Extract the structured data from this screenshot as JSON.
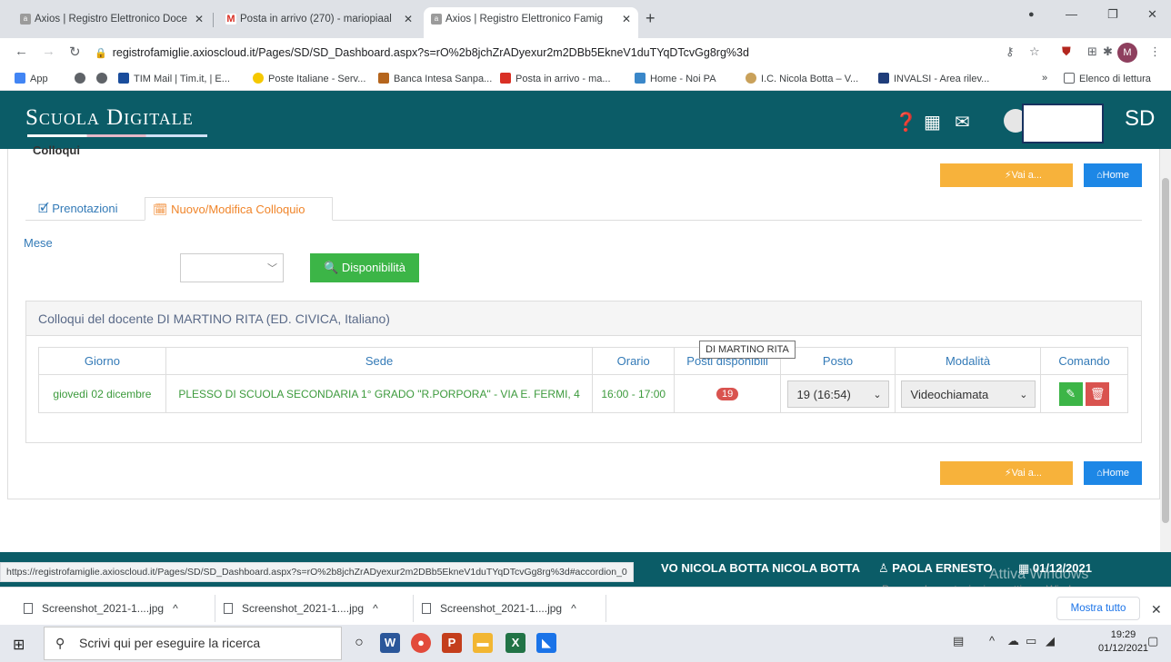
{
  "browser": {
    "tabs": [
      {
        "label": "Axios | Registro Elettronico Doce",
        "active": false
      },
      {
        "label": "Posta in arrivo (270) - mariopiaal",
        "active": false
      },
      {
        "label": "Axios | Registro Elettronico Famig",
        "active": true
      }
    ],
    "url": "registrofamiglie.axioscloud.it/Pages/SD/SD_Dashboard.aspx?s=rO%2b8jchZrADyexur2m2DBb5EkneV1duTYqDTcvGg8rg%3d",
    "profile_initial": "M",
    "bookmarks": [
      "App",
      "TIM Mail | Tim.it, | E...",
      "Poste Italiane - Serv...",
      "Banca Intesa Sanpa...",
      "Posta in arrivo - ma...",
      "Home - Noi PA",
      "I.C. Nicola Botta – V...",
      "INVALSI - Area rilev..."
    ],
    "reading_list": "Elenco di lettura",
    "overflow": "»"
  },
  "app": {
    "brand": "Scuola Digitale",
    "logo": "SD"
  },
  "page": {
    "section_title": "Colloqui",
    "vai_a_label": "Vai a...",
    "home_label": "Home",
    "tabs": [
      "Prenotazioni",
      "Nuovo/Modifica Colloquio"
    ],
    "mese_label": "Mese",
    "mese_value": "",
    "disponibilita_label": "Disponibilità",
    "box_title": "Colloqui del docente DI MARTINO RITA (ED. CIVICA, Italiano)",
    "table": {
      "headers": [
        "Giorno",
        "Sede",
        "Orario",
        "Posti disponibili",
        "Posto",
        "Modalità",
        "Comando"
      ],
      "rows": [
        {
          "giorno": "giovedì 02 dicembre",
          "sede": "PLESSO DI SCUOLA SECONDARIA 1° GRADO \"R.PORPORA\" - VIA E. FERMI, 4",
          "orario": "16:00 - 17:00",
          "posti": "19",
          "posto": "19 (16:54)",
          "modalita": "Videochiamata"
        }
      ]
    },
    "tooltip": "DI MARTINO RITA"
  },
  "footer": {
    "school": "VO NICOLA BOTTA NICOLA BOTTA",
    "user": "PAOLA ERNESTO",
    "date": "01/12/2021",
    "status_url": "https://registrofamiglie.axioscloud.it/Pages/SD/SD_Dashboard.aspx?s=rO%2b8jchZrADyexur2m2DBb5EkneV1duTYqDTcvGg8rg%3d#accordion_0",
    "watermark_title": "Attiva Windows",
    "watermark_sub": "Passa a Impostazioni per attivare Windows."
  },
  "downloads": {
    "items": [
      "Screenshot_2021-1....jpg",
      "Screenshot_2021-1....jpg",
      "Screenshot_2021-1....jpg"
    ],
    "show_all": "Mostra tutto"
  },
  "taskbar": {
    "search_placeholder": "Scrivi qui per eseguire la ricerca",
    "time": "19:29",
    "date": "01/12/2021"
  },
  "colors": {
    "header_teal": "#0b5c67",
    "vai_orange": "#f7b23b",
    "home_blue": "#1d87e6",
    "disp_green": "#3cb547",
    "badge_red": "#d9534f"
  }
}
